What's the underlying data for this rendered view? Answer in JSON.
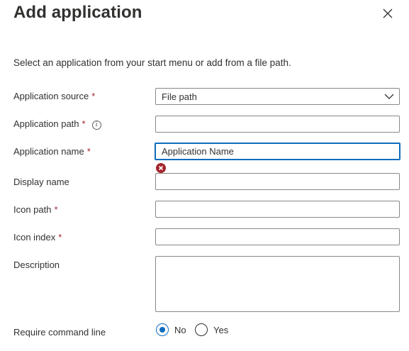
{
  "panel": {
    "title": "Add application",
    "intro": "Select an application from your start menu or add from a file path."
  },
  "fields": {
    "source": {
      "label": "Application source",
      "required": "*",
      "value": "File path"
    },
    "path": {
      "label": "Application path",
      "required": "*",
      "value": ""
    },
    "name": {
      "label": "Application name",
      "required": "*",
      "value": "Application Name"
    },
    "display_name": {
      "label": "Display name",
      "value": ""
    },
    "icon_path": {
      "label": "Icon path",
      "required": "*",
      "value": ""
    },
    "icon_index": {
      "label": "Icon index",
      "required": "*",
      "value": ""
    },
    "description": {
      "label": "Description",
      "value": ""
    }
  },
  "command_line": {
    "label": "Require command line",
    "options": [
      {
        "label": "No",
        "selected": true
      },
      {
        "label": "Yes",
        "selected": false
      }
    ]
  },
  "icons": {
    "close": "close-icon",
    "info": "info-icon",
    "error": "error-icon",
    "dropdown": "chevron-down-icon"
  },
  "colors": {
    "accent": "#0f6cbd",
    "required": "#a4262c",
    "error": "#a4262c"
  }
}
